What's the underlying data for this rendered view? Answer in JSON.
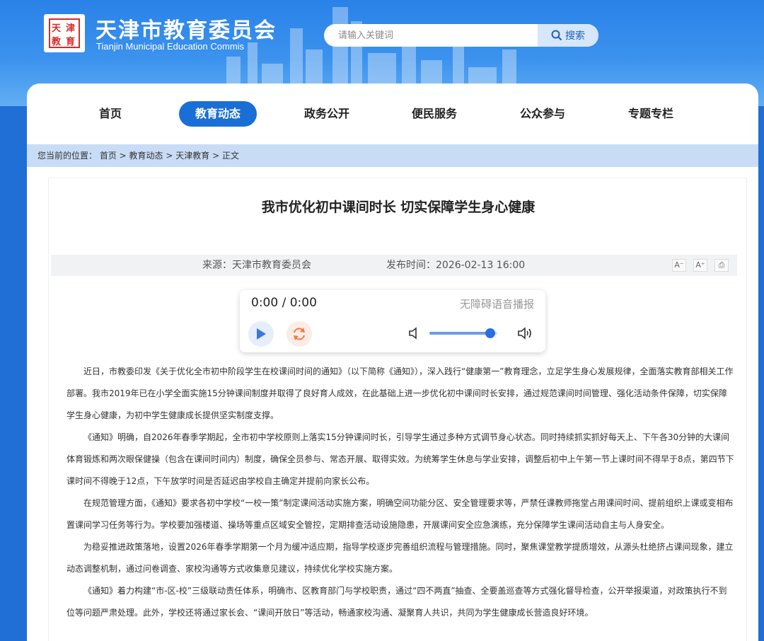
{
  "header": {
    "logo_text": "天津教育",
    "site_title": "天津市教育委员会",
    "site_subtitle": "Tianjin Municipal Education Commis",
    "search_placeholder": "请输入关键词",
    "search_button": "搜索"
  },
  "nav": {
    "items": [
      {
        "label": "首页"
      },
      {
        "label": "教育动态"
      },
      {
        "label": "政务公开"
      },
      {
        "label": "便民服务"
      },
      {
        "label": "公众参与"
      },
      {
        "label": "专题专栏"
      }
    ]
  },
  "breadcrumb": {
    "prefix": "您当前的位置：",
    "items": [
      "首页",
      "教育动态",
      "天津教育",
      "正文"
    ],
    "separator": " > "
  },
  "article": {
    "title": "我市优化初中课间时长 切实保障学生身心健康",
    "source_label": "来源：",
    "source": "天津市教育委员会",
    "time_label": "发布时间：",
    "time": "2026-02-13 16:00",
    "tools": [
      "A⁻",
      "A⁺",
      "⎙"
    ],
    "paragraphs": [
      "近日，市教委印发《关于优化全市初中阶段学生在校课间时间的通知》（以下简称《通知》），深入践行“健康第一”教育理念，立足学生身心发展规律，全面落实教育部相关工作部署。我市2019年已在小学全面实施15分钟课间制度并取得了良好育人成效，在此基础上进一步优化初中课间时长安排，通过规范课间时间管理、强化活动条件保障，切实保障学生身心健康，为初中学生健康成长提供坚实制度支撑。",
      "《通知》明确，自2026年春季学期起，全市初中学校原则上落实15分钟课间时长，引导学生通过多种方式调节身心状态。同时持续抓实抓好每天上、下午各30分钟的大课间体育锻炼和两次眼保健操（包含在课间时间内）制度，确保全员参与、常态开展、取得实效。为统筹学生休息与学业安排，调整后初中上午第一节上课时间不得早于8点，第四节下课时间不得晚于12点，下午放学时间是否延迟由学校自主确定并提前向家长公布。",
      "在规范管理方面，《通知》要求各初中学校“一校一策”制定课间活动实施方案，明确空间功能分区、安全管理要求等，严禁任课教师拖堂占用课间时间、提前组织上课或变相布置课间学习任务等行为。学校要加强楼道、操场等重点区域安全管控，定期排查活动设施隐患，开展课间安全应急演练，充分保障学生课间活动自主与人身安全。",
      "为稳妥推进政策落地，设置2026年春季学期第一个月为缓冲适应期，指导学校逐步完善组织流程与管理措施。同时，聚焦课堂教学提质增效，从源头杜绝挤占课间现象，建立动态调整机制，通过问卷调查、家校沟通等方式收集意见建议，持续优化学校实施方案。",
      "《通知》着力构建“市-区-校”三级联动责任体系，明确市、区教育部门与学校职责，通过“四不两直”抽查、全要盖巡查等方式强化督导检查，公开举报渠道，对政策执行不到位等问题严肃处理。此外，学校还将通过家长会、“课间开放日”等活动，畅通家校沟通、凝聚育人共识，共同为学生健康成长营造良好环境。"
    ]
  },
  "player": {
    "time": "0:00 / 0:00",
    "label": "无障碍语音播报",
    "volume": 0.9
  },
  "colors": {
    "accent": "#1a6fd6",
    "banner": "#2a82e8",
    "breadcrumb_bg": "#c8dcf5"
  }
}
